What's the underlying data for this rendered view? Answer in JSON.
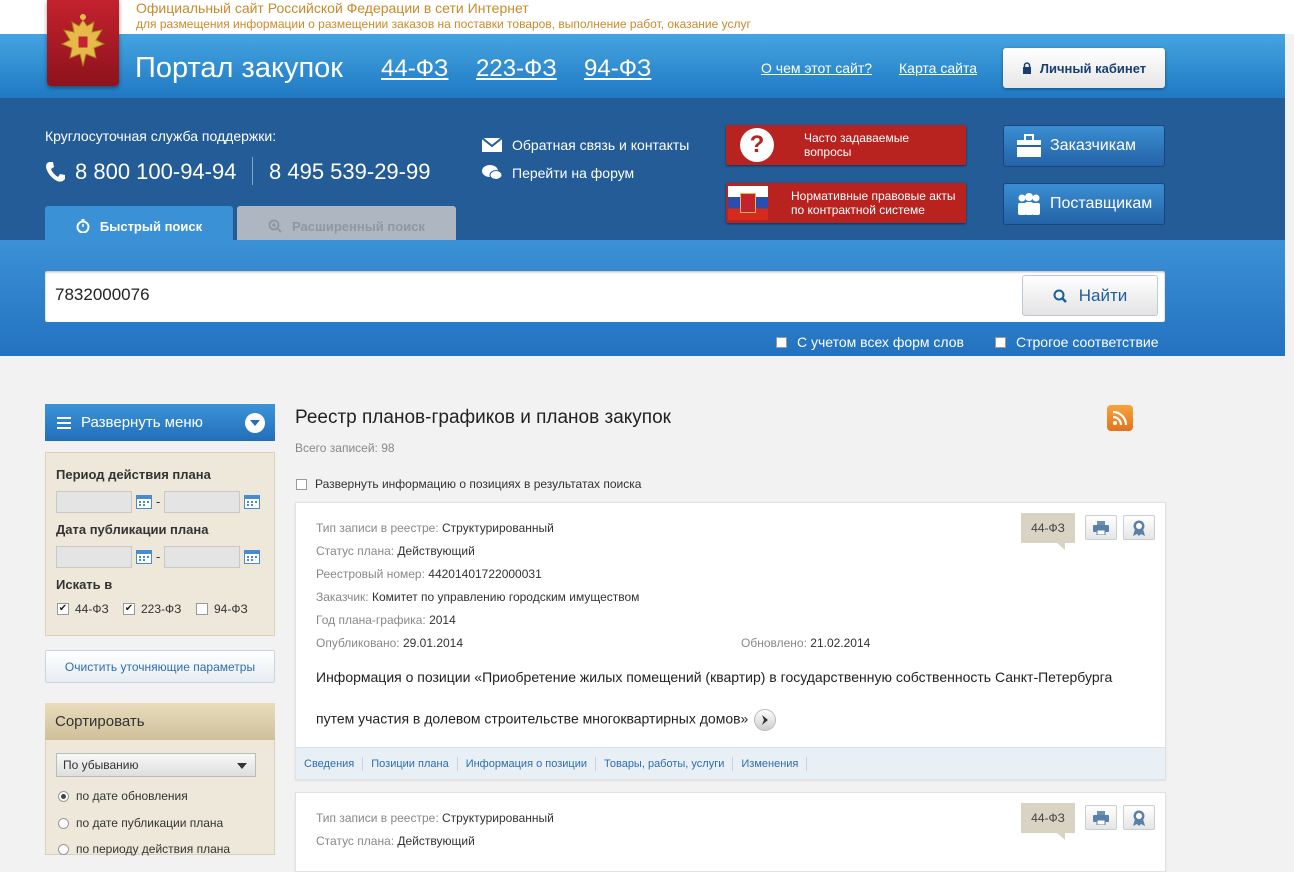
{
  "header": {
    "official_title": "Официальный сайт Российской Федерации в сети Интернет",
    "official_subtitle": "для размещения информации о размещении заказов на поставки товаров, выполнение работ, оказание услуг",
    "portal_title": "Портал закупок",
    "law_links": [
      "44-ФЗ",
      "223-ФЗ",
      "94-ФЗ"
    ],
    "about_link": "О чем этот сайт?",
    "sitemap_link": "Карта сайта",
    "cabinet_button": "Личный кабинет"
  },
  "support": {
    "label": "Круглосуточная служба поддержки:",
    "phone1": "8 800 100-94-94",
    "phone2": "8 495 539-29-99",
    "feedback_link": "Обратная связь и контакты",
    "forum_link": "Перейти на форум",
    "faq_button": "Часто задаваемые вопросы",
    "acts_button": "Нормативные правовые акты по контрактной системе",
    "customers_button": "Заказчикам",
    "suppliers_button": "Поставщикам"
  },
  "search": {
    "tab_quick": "Быстрый поиск",
    "tab_advanced": "Расширенный поиск",
    "query": "7832000076",
    "button": "Найти",
    "option_word_forms": "С учетом всех форм слов",
    "option_strict": "Строгое соответствие"
  },
  "sidebar": {
    "menu_button": "Развернуть меню",
    "period_label": "Период действия плана",
    "publication_label": "Дата публикации плана",
    "search_in_label": "Искать в",
    "laws": [
      {
        "label": "44-ФЗ",
        "checked": true
      },
      {
        "label": "223-ФЗ",
        "checked": true
      },
      {
        "label": "94-ФЗ",
        "checked": false
      }
    ],
    "clear_button": "Очистить уточняющие параметры",
    "sort_title": "Сортировать",
    "sort_order": "По убыванию",
    "sort_options": [
      "по дате обновления",
      "по дате публикации плана",
      "по периоду действия плана"
    ],
    "sort_selected": 0
  },
  "main": {
    "title": "Реестр планов-графиков и планов закупок",
    "total_label": "Всего записей:",
    "total_count": "98",
    "expand_option": "Развернуть информацию о позициях в результатах поиска"
  },
  "labels": {
    "record_type": "Тип записи в реестре:",
    "plan_status": "Статус плана:",
    "registry_number": "Реестровый номер:",
    "customer": "Заказчик:",
    "plan_year": "Год плана-графика:",
    "published": "Опубликовано:",
    "updated": "Обновлено:"
  },
  "results": [
    {
      "law": "44-ФЗ",
      "record_type": "Структурированный",
      "plan_status": "Действующий",
      "registry_number": "44201401722000031",
      "customer": "Комитет по управлению городским имуществом",
      "plan_year": "2014",
      "published": "29.01.2014",
      "updated": "21.02.2014",
      "info_line1": "Информация о позиции «Приобретение жилых помещений (квартир) в государственную собственность Санкт-Петербурга",
      "info_line2": "путем участия в долевом строительстве многоквартирных домов»",
      "tabs": [
        "Сведения",
        "Позиции плана",
        "Информация о позиции",
        "Товары, работы, услуги",
        "Изменения"
      ]
    },
    {
      "law": "44-ФЗ",
      "record_type": "Структурированный",
      "plan_status": "Действующий"
    }
  ],
  "colors": {
    "nav_blue": "#1f79c3",
    "band_blue": "#235c97",
    "red_button": "#b8231f",
    "beige_panel": "#ede8da",
    "gold_text": "#c88b2c"
  }
}
